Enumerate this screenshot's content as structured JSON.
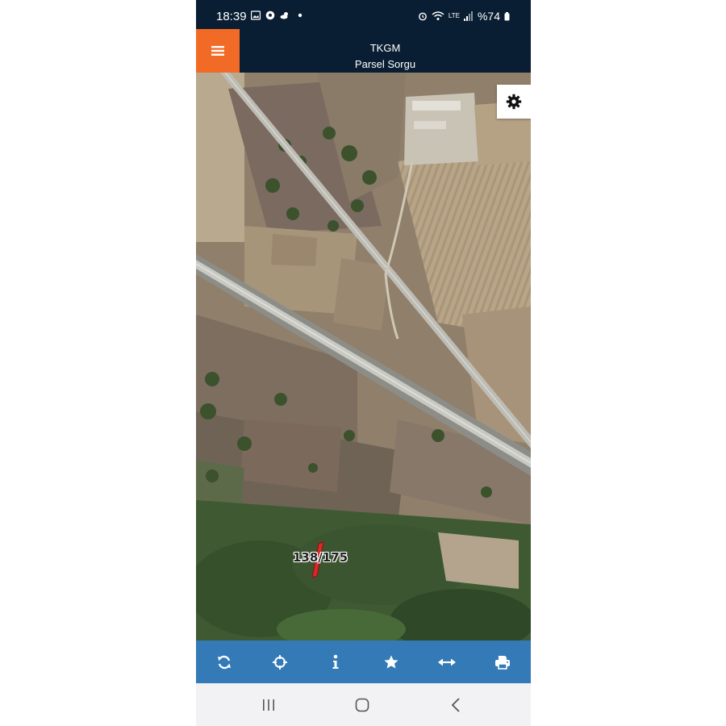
{
  "status_bar": {
    "time": "18:39",
    "battery": "%74",
    "network": "LTE",
    "icons": [
      "gallery-icon",
      "soccer-ball-icon",
      "weather-icon",
      "dot-icon",
      "alarm-icon",
      "wifi-icon",
      "signal-icon",
      "battery-icon"
    ]
  },
  "header": {
    "title": "TKGM",
    "subtitle": "Parsel Sorgu",
    "menu_icon": "hamburger-menu-icon",
    "accent_color": "#f26b26",
    "background_color": "#0a1e33"
  },
  "map": {
    "settings_icon": "gear-icon",
    "parcel_label": "138/175",
    "parcel_color": "#d42a2a"
  },
  "toolbar": {
    "background_color": "#337ab7",
    "buttons": [
      {
        "icon": "refresh-icon"
      },
      {
        "icon": "locate-crosshair-icon"
      },
      {
        "icon": "info-icon"
      },
      {
        "icon": "star-icon"
      },
      {
        "icon": "measure-arrows-icon"
      },
      {
        "icon": "print-icon"
      }
    ]
  },
  "nav_bar": {
    "buttons": [
      {
        "icon": "recent-apps-icon"
      },
      {
        "icon": "home-icon"
      },
      {
        "icon": "back-icon"
      }
    ]
  }
}
